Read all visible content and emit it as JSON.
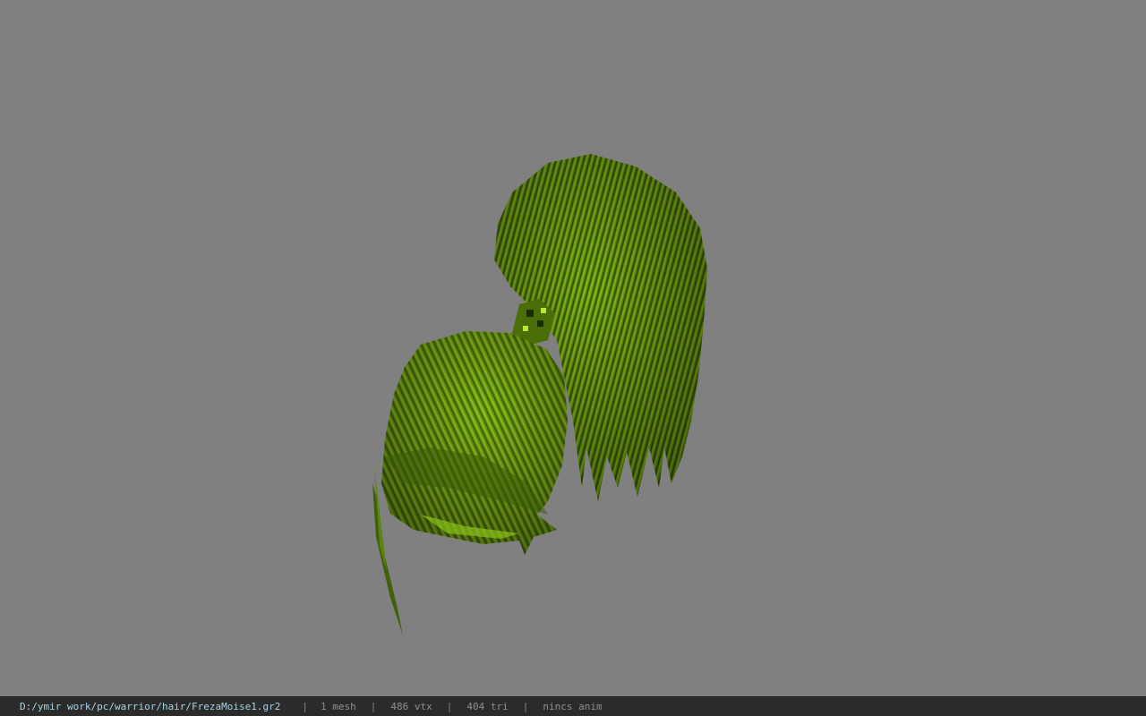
{
  "viewer": {
    "background_color": "#808080",
    "model_name": "FrezaMoise1",
    "model_color": "#6a9a10"
  },
  "status": {
    "path": "D:/ymir work/pc/warrior/hair/FrezaMoise1.gr2",
    "separator": "|",
    "mesh": "1 mesh",
    "vtx": "486 vtx",
    "tri": "404 tri",
    "anim": "nincs anim"
  }
}
